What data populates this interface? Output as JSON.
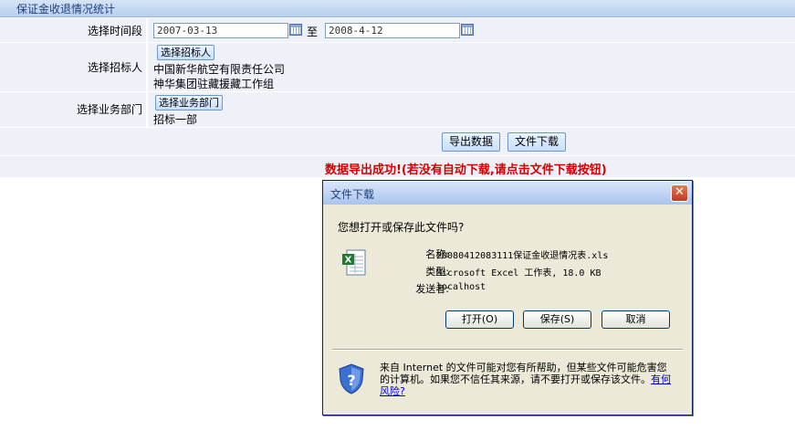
{
  "page_title": "保证金收退情况统计",
  "form": {
    "time_label": "选择时间段",
    "start_date": "2007-03-13",
    "to_text": "至",
    "end_date": "2008-4-12",
    "bidder_label": "选择招标人",
    "bidder_button": "选择招标人",
    "bidders": [
      "中国新华航空有限责任公司",
      "神华集团驻藏援藏工作组"
    ],
    "dept_label": "选择业务部门",
    "dept_button": "选择业务部门",
    "dept_value": "招标一部",
    "export_button": "导出数据",
    "download_button": "文件下载",
    "success_message": "数据导出成功!(若没有自动下载,请点击文件下载按钮)"
  },
  "dialog": {
    "title": "文件下载",
    "close_icon": "close-icon",
    "question": "您想打开或保存此文件吗?",
    "name_label": "名称:",
    "name_value": "20080412083111保证金收退情况表.xls",
    "type_label": "类型:",
    "type_value": "Microsoft Excel 工作表, 18.0 KB",
    "from_label": "发送者:",
    "from_value": "localhost",
    "open_button": "打开(O)",
    "save_button": "保存(S)",
    "cancel_button": "取消",
    "warning_text": "来自 Internet 的文件可能对您有所帮助，但某些文件可能危害您的计算机。如果您不信任其来源，请不要打开或保存该文件。",
    "risk_link": "有何风险?"
  }
}
